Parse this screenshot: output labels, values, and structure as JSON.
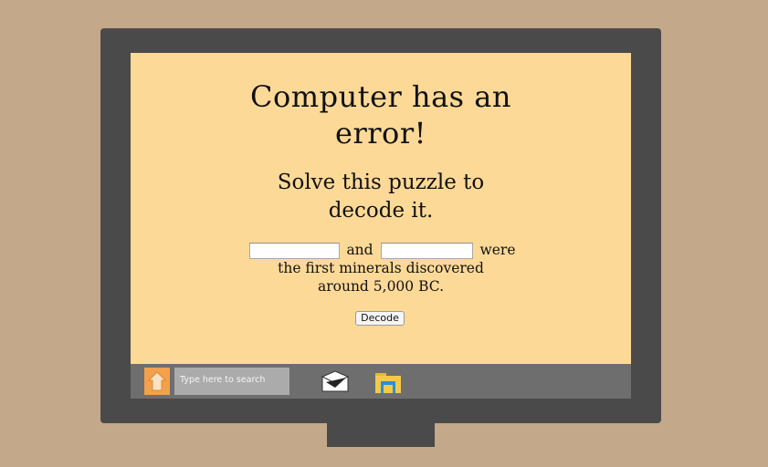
{
  "screen": {
    "title_line1": "Computer has an",
    "title_line2": "error!",
    "subtitle_line1": "Solve this puzzle to",
    "subtitle_line2": "decode it.",
    "puzzle": {
      "blank1_value": "",
      "connector": "and",
      "after_blank2": "were",
      "line2": "the first minerals discovered",
      "line3": "around 5,000 BC."
    },
    "decode_label": "Decode"
  },
  "taskbar": {
    "search_placeholder": "Type here to search",
    "icons": [
      "home-icon",
      "mail-icon",
      "folder-icon"
    ]
  },
  "colors": {
    "background": "#c4a88a",
    "monitor": "#4a4a4a",
    "screen": "#fdd998",
    "taskbar": "#6e6e6e",
    "start_button": "#f2a14c"
  }
}
